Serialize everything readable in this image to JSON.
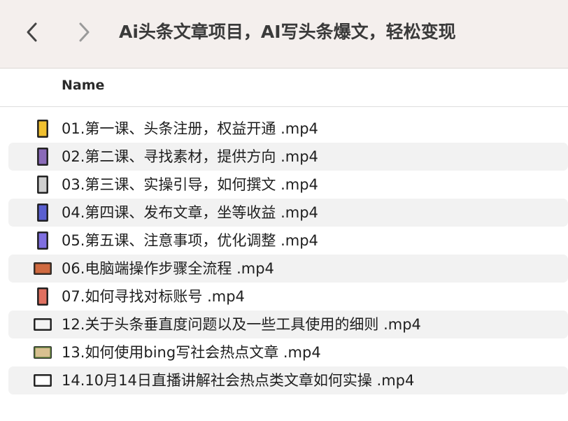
{
  "window": {
    "title": "Ai头条文章项目，AI写头条爆文，轻松变现"
  },
  "toolbar": {
    "back_icon": "chevron-left-icon",
    "forward_icon": "chevron-right-icon"
  },
  "columns": {
    "name": "Name"
  },
  "files": [
    {
      "name": "01.第一课、头条注册，权益开通 .mp4",
      "icon": "video-thumbnail-portrait-icon",
      "colors": [
        "#1b1b1b",
        "#f0c030"
      ]
    },
    {
      "name": "02.第二课、寻找素材，提供方向 .mp4",
      "icon": "video-thumbnail-portrait-icon",
      "colors": [
        "#1b1b1b",
        "#8a6ab8"
      ]
    },
    {
      "name": "03.第三课、实操引导，如何撰文 .mp4",
      "icon": "video-thumbnail-portrait-icon",
      "colors": [
        "#1b1b1b",
        "#cfcfcf"
      ]
    },
    {
      "name": "04.第四课、发布文章，坐等收益 .mp4",
      "icon": "video-thumbnail-portrait-icon",
      "colors": [
        "#1b1b1b",
        "#5a5fd0"
      ]
    },
    {
      "name": "05.第五课、注意事项，优化调整 .mp4",
      "icon": "video-thumbnail-portrait-icon",
      "colors": [
        "#1b1b1b",
        "#7f6fe0"
      ]
    },
    {
      "name": "06.电脑端操作步骤全流程 .mp4",
      "icon": "video-thumbnail-landscape-icon",
      "colors": [
        "#3a2a20",
        "#d06a40"
      ]
    },
    {
      "name": "07.如何寻找对标账号 .mp4",
      "icon": "video-thumbnail-portrait-icon",
      "colors": [
        "#1b1b1b",
        "#e07060"
      ]
    },
    {
      "name": "12.关于头条垂直度问题以及一些工具使用的细则 .mp4",
      "icon": "video-thumbnail-landscape-icon",
      "colors": [
        "#1b1b1b",
        "#f4f4f4"
      ]
    },
    {
      "name": "13.如何使用bing写社会热点文章 .mp4",
      "icon": "video-thumbnail-landscape-icon",
      "colors": [
        "#4a6a30",
        "#d8c090"
      ]
    },
    {
      "name": "14.10月14日直播讲解社会热点类文章如何实操 .mp4",
      "icon": "video-thumbnail-landscape-icon",
      "colors": [
        "#1b1b1b",
        "#ffffff"
      ]
    }
  ]
}
